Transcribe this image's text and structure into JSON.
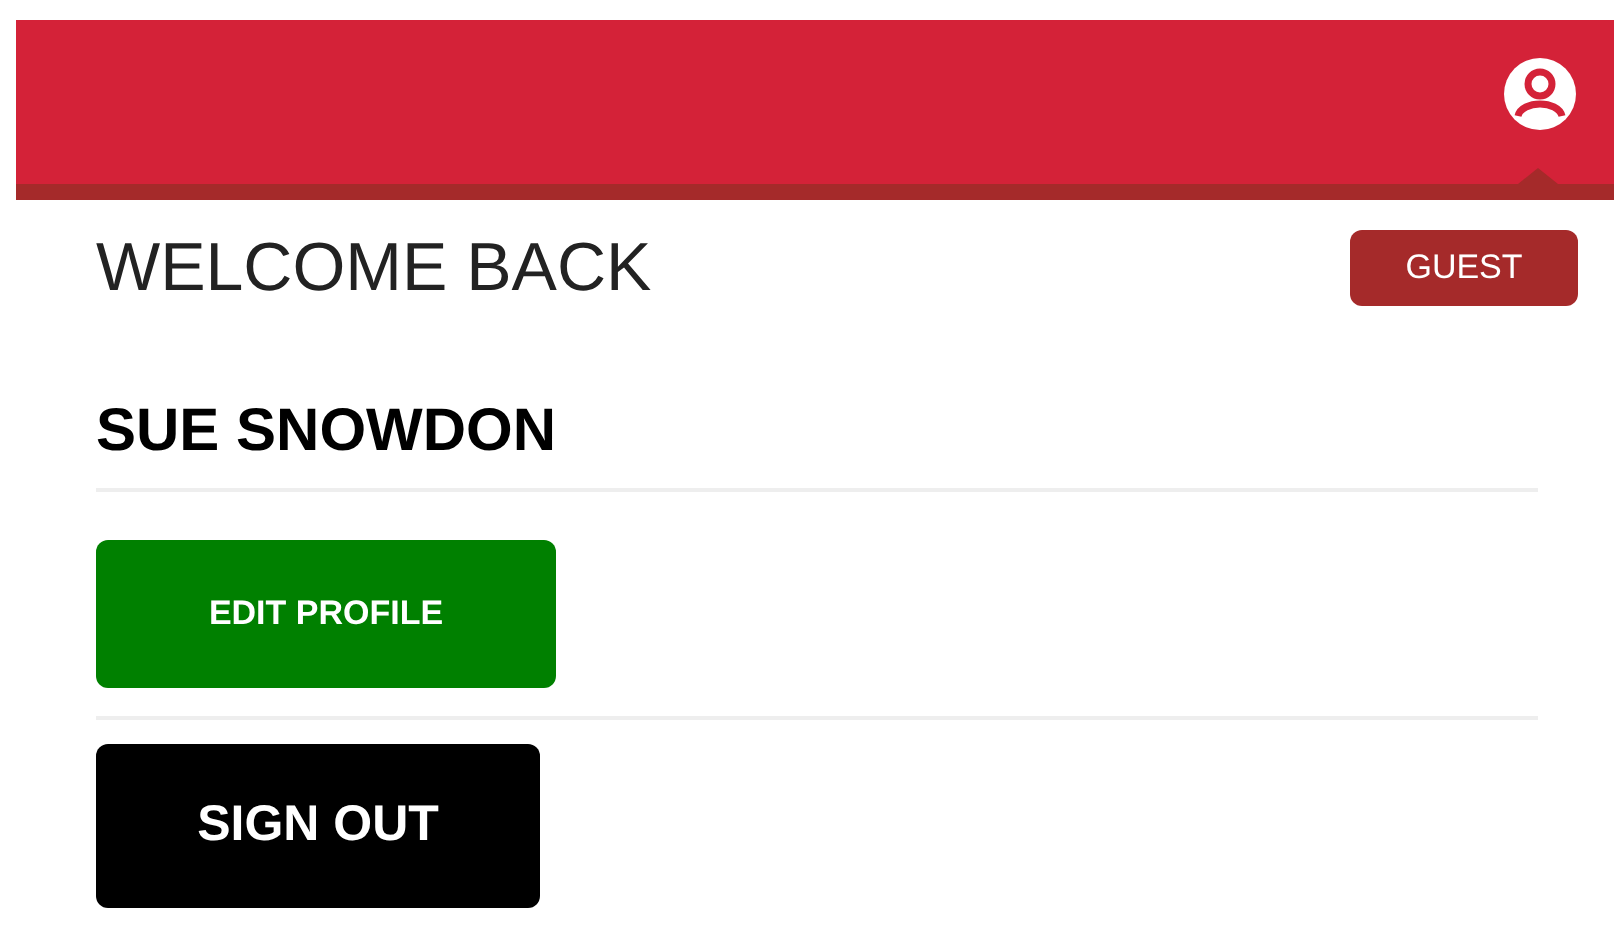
{
  "header": {
    "kind": "account"
  },
  "greeting": "WELCOME BACK",
  "badge": "GUEST",
  "user_name": "SUE SNOWDON",
  "buttons": [
    {
      "label": "EDIT PROFILE",
      "kind": "primary"
    },
    {
      "label": "SIGN OUT",
      "kind": "dark"
    }
  ]
}
